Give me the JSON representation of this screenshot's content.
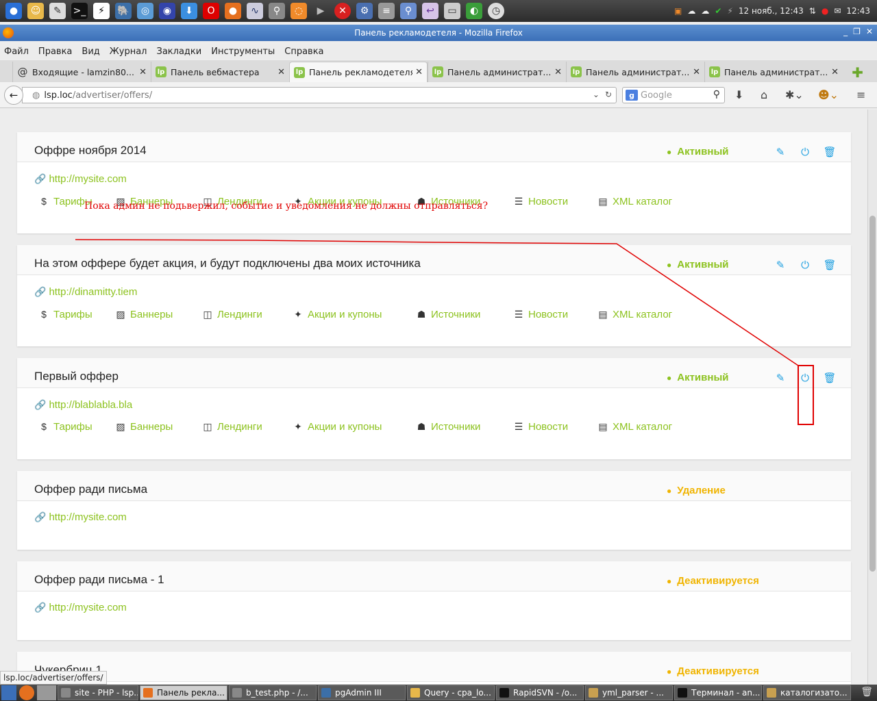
{
  "system_panel": {
    "clock_date": "12 нояб., 12:43",
    "clock_time": "12:43",
    "colors": {
      "panel": "#3a3a3a"
    }
  },
  "window": {
    "title": "Панель рекламодетеля - Mozilla Firefox",
    "menu": [
      "Файл",
      "Правка",
      "Вид",
      "Журнал",
      "Закладки",
      "Инструменты",
      "Справка"
    ],
    "tabs": [
      {
        "label": "Входящие - lamzin80...",
        "icon": "at-icon"
      },
      {
        "label": "Панель вебмастера",
        "icon": "lp-icon"
      },
      {
        "label": "Панель рекламодетеля",
        "icon": "lp-icon",
        "active": true
      },
      {
        "label": "Панель администрат...",
        "icon": "lp-icon"
      },
      {
        "label": "Панель администрат...",
        "icon": "lp-icon"
      },
      {
        "label": "Панель администрат...",
        "icon": "lp-icon"
      }
    ],
    "url_host": "lsp.loc",
    "url_path": "/advertiser/offers/",
    "search_placeholder": "Google"
  },
  "nav_labels": {
    "tariffs": "Тарифы",
    "banners": "Баннеры",
    "landings": "Лендинги",
    "promos": "Акции и купоны",
    "sources": "Источники",
    "news": "Новости",
    "xml": "XML каталог"
  },
  "offers": [
    {
      "title": "Оффре ноября 2014",
      "status": "Активный",
      "status_color": "#8cc21e",
      "url": "http://mysite.com"
    },
    {
      "title": "На этом оффере будет акция, и будут подключены два моих источника",
      "status": "Активный",
      "status_color": "#8cc21e",
      "url": "http://dinamitty.tiem"
    },
    {
      "title": "Первый оффер",
      "status": "Активный",
      "status_color": "#8cc21e",
      "url": "http://blablabla.bla"
    },
    {
      "title": "Оффер ради письма",
      "status": "Удаление",
      "status_color": "#f0b400",
      "url": "http://mysite.com"
    },
    {
      "title": "Оффер ради письма - 1",
      "status": "Деактивируется",
      "status_color": "#f0b400",
      "url": "http://mysite.com"
    },
    {
      "title": "Чукербриц 1",
      "status": "Деактивируется",
      "status_color": "#f0b400"
    }
  ],
  "annotation": {
    "text": "Пока админ не подьвержил, событие и уведомления не должны отправляться?",
    "color": "#e00000"
  },
  "status_bar_url": "lsp.loc/advertiser/offers/",
  "taskbar": [
    {
      "label": "site - PHP - lsp..."
    },
    {
      "label": "Панель рекла...",
      "active": true
    },
    {
      "label": "b_test.php - /..."
    },
    {
      "label": "pgAdmin III"
    },
    {
      "label": "Query - cpa_lo..."
    },
    {
      "label": "RapidSVN - /o..."
    },
    {
      "label": "yml_parser - ..."
    },
    {
      "label": "Терминал - an..."
    },
    {
      "label": "каталогизато..."
    }
  ]
}
